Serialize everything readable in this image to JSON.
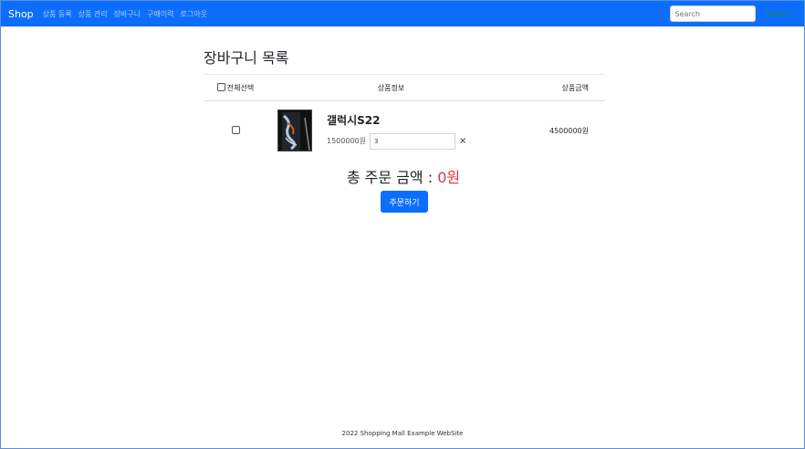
{
  "navbar": {
    "brand": "Shop",
    "links": [
      "상품 등록",
      "상품 관리",
      "장바구니",
      "구매이력",
      "로그아웃"
    ],
    "search_placeholder": "Search",
    "search_button": "Search"
  },
  "page_title": "장바구니 목록",
  "cart_table": {
    "headers": {
      "select_all": "전체선택",
      "product_info": "상품정보",
      "product_price": "상품금액"
    },
    "items": [
      {
        "name": "갤럭시S22",
        "unit_price": "1500000원",
        "quantity": "3",
        "total": "4500000원",
        "remove": "×"
      }
    ]
  },
  "order": {
    "label": "총 주문 금액 : ",
    "amount": "0원",
    "button": "주문하기"
  },
  "footer": "2022 Shopping Mall Example WebSite",
  "colors": {
    "primary": "#0d6efd",
    "danger": "#dc3545",
    "success": "#198754"
  }
}
